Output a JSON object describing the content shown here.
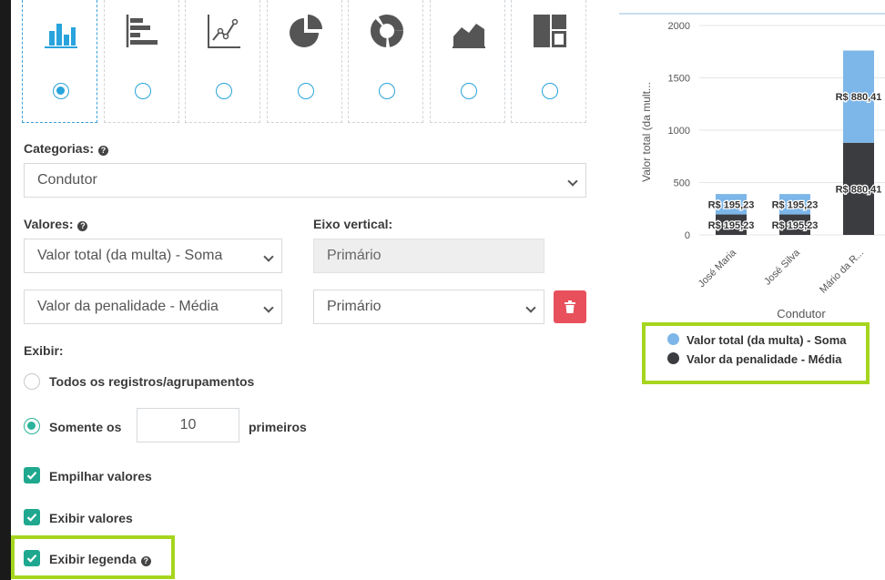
{
  "chart_types": [
    {
      "name": "bar-chart-icon",
      "selected": true
    },
    {
      "name": "horizontal-bar-chart-icon",
      "selected": false
    },
    {
      "name": "line-chart-icon",
      "selected": false
    },
    {
      "name": "pie-chart-icon",
      "selected": false
    },
    {
      "name": "donut-chart-icon",
      "selected": false
    },
    {
      "name": "area-chart-icon",
      "selected": false
    },
    {
      "name": "treemap-icon",
      "selected": false
    }
  ],
  "categories": {
    "label": "Categorias:",
    "value": "Condutor"
  },
  "values": {
    "label": "Valores:",
    "axis_label": "Eixo vertical:",
    "rows": [
      {
        "value": "Valor total (da multa) - Soma",
        "axis": "Primário"
      },
      {
        "value": "Valor da penalidade - Média",
        "axis": "Primário"
      }
    ]
  },
  "display": {
    "label": "Exibir:",
    "all_records": "Todos os registros/agrupamentos",
    "only_first_prefix": "Somente os",
    "only_first_count": "10",
    "only_first_suffix": "primeiros"
  },
  "options": {
    "stack_values": "Empilhar valores",
    "show_values": "Exibir valores",
    "show_legend": "Exibir legenda"
  },
  "colors": {
    "series1": "#7db6e8",
    "series2": "#3a3c40",
    "accent": "#29a3dc",
    "check": "#1fa88f",
    "highlight": "#a6d51f",
    "danger": "#e8505b"
  },
  "chart_data": {
    "type": "bar",
    "stacked": true,
    "categories": [
      "José Maria",
      "José Silva",
      "Mário da R..."
    ],
    "series": [
      {
        "name": "Valor total (da multa) - Soma",
        "values": [
          195.23,
          195.23,
          880.41
        ],
        "labels": [
          "R$ 195,23",
          "R$ 195,23",
          "R$ 880,41"
        ]
      },
      {
        "name": "Valor da penalidade - Média",
        "values": [
          195.23,
          195.23,
          880.41
        ],
        "labels": [
          "R$ 195,23",
          "R$ 195,23",
          "R$ 880,41"
        ]
      }
    ],
    "xlabel": "Condutor",
    "ylabel": "Valor total (da mult...",
    "ylim": [
      0,
      2000
    ],
    "yticks": [
      "0",
      "500",
      "1000",
      "1500",
      "2000"
    ],
    "legend_position": "bottom"
  }
}
